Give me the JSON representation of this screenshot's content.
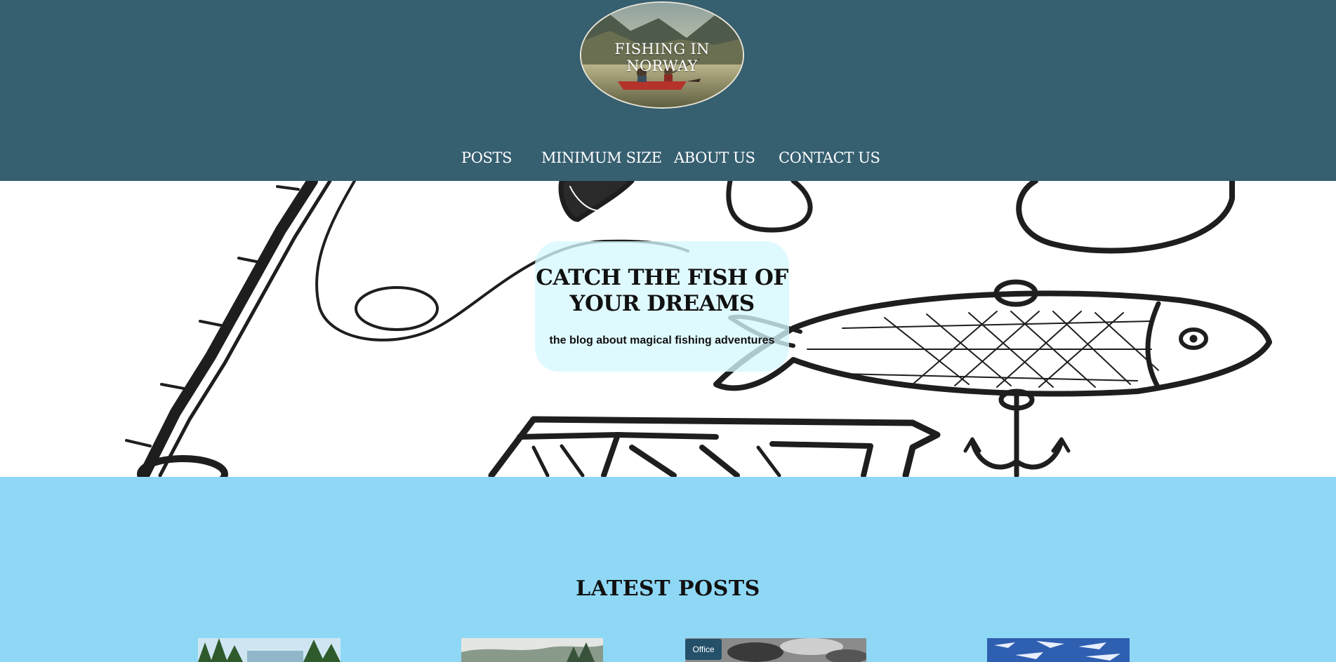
{
  "header": {
    "logo_text": "FISHING IN NORWAY",
    "background_color": "#365f70"
  },
  "nav": {
    "items": [
      {
        "label": "POSTS"
      },
      {
        "label": "MINIMUM SIZE"
      },
      {
        "label": "ABOUT US"
      },
      {
        "label": "CONTACT US"
      }
    ]
  },
  "hero": {
    "title": "CATCH THE FISH OF YOUR DREAMS",
    "subtitle": "the blog about magical fishing adventures"
  },
  "latest": {
    "title": "LATEST POSTS",
    "background_color": "#8ed8f5",
    "posts": [
      {
        "category": ""
      },
      {
        "category": ""
      },
      {
        "category": "Office"
      },
      {
        "category": ""
      }
    ]
  }
}
